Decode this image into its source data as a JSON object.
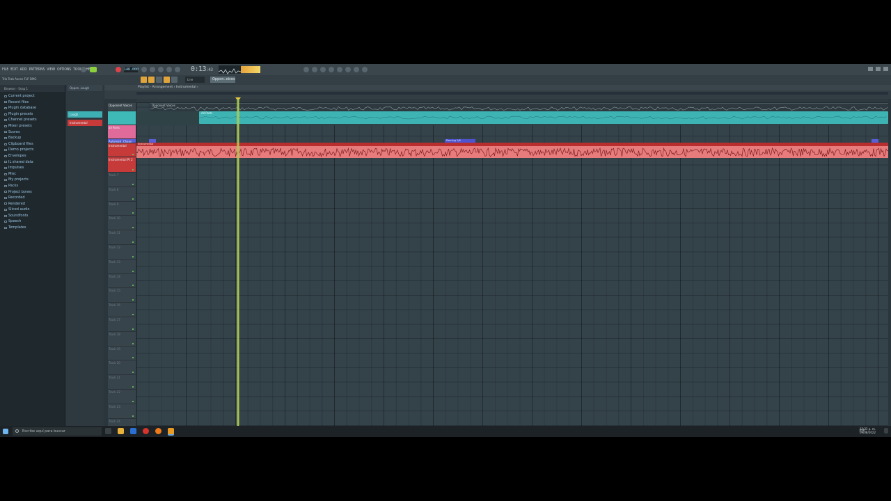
{
  "menu": [
    "FILE",
    "EDIT",
    "ADD",
    "PATTERNS",
    "VIEW",
    "OPTIONS",
    "TOOLS",
    "HELP"
  ],
  "transport": {
    "tempo": "146.000",
    "time_main": "0:13",
    "time_sub": ":43"
  },
  "hint": "Trib Trab Aeons FLP DMG",
  "snap": "Line",
  "pattern": "Oppon..oices",
  "browser": {
    "header": "Browser - Snap 1",
    "items": [
      "Current project",
      "Recent files",
      "Plugin database",
      "Plugin presets",
      "Channel presets",
      "Mixer presets",
      "Scores",
      "Backup",
      "Clipboard files",
      "Demo projects",
      "Envelopes",
      "IL shared data",
      "Impulses",
      "Misc",
      "My projects",
      "Packs",
      "Project bones",
      "Recorded",
      "Rendered",
      "Sliced audio",
      "Soundfonts",
      "Speech",
      "Templates"
    ]
  },
  "channels": {
    "header": "Oppon..Laugh",
    "items": [
      {
        "label": "Laugh",
        "color": "#3eb0b4"
      },
      {
        "label": "Instrumental",
        "color": "#c63a3a"
      }
    ]
  },
  "playlist": {
    "title": "Playlist - Arrangement › Instrumental ›",
    "tracks": [
      {
        "label": "Opponent Voices",
        "color": "#3a464c"
      },
      {
        "label": "",
        "color": "#3fb8b8"
      },
      {
        "label": "all Parts",
        "color": "#e06a9a"
      },
      {
        "label": "Automati..Chann",
        "color": "#5a5fd6"
      },
      {
        "label": "Instrumental",
        "color": "#c63a3a"
      },
      {
        "label": "Instrumental Pt 2",
        "color": "#c63a3a"
      }
    ],
    "empty_tracks": [
      "Track 7",
      "Track 8",
      "Track 9",
      "Track 10",
      "Track 11",
      "Track 12",
      "Track 13",
      "Track 14",
      "Track 15",
      "Track 16",
      "Track 17",
      "Track 18",
      "Track 19",
      "Track 20",
      "Track 21",
      "Track 22",
      "Track 23",
      "Track 24",
      "Track 25",
      "Track 26"
    ],
    "clips": {
      "voices": "Opponent Voices",
      "all": "All Parts",
      "automation1": "Panning 1/8",
      "automation2": "Panning 1/8/2",
      "instrumental": "Instrumental"
    }
  },
  "taskbar": {
    "search": "Escribe aquí para buscar",
    "lang": "ESP",
    "time": "12:33 p. m.",
    "date": "09/08/2022"
  }
}
